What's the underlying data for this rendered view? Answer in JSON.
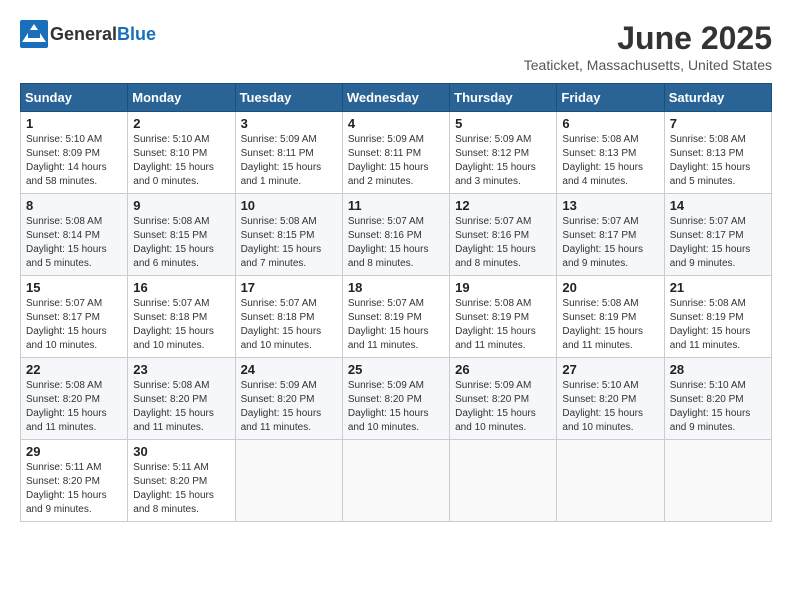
{
  "header": {
    "logo_general": "General",
    "logo_blue": "Blue",
    "month_title": "June 2025",
    "location": "Teaticket, Massachusetts, United States"
  },
  "weekdays": [
    "Sunday",
    "Monday",
    "Tuesday",
    "Wednesday",
    "Thursday",
    "Friday",
    "Saturday"
  ],
  "weeks": [
    [
      {
        "day": "1",
        "info": "Sunrise: 5:10 AM\nSunset: 8:09 PM\nDaylight: 14 hours\nand 58 minutes."
      },
      {
        "day": "2",
        "info": "Sunrise: 5:10 AM\nSunset: 8:10 PM\nDaylight: 15 hours\nand 0 minutes."
      },
      {
        "day": "3",
        "info": "Sunrise: 5:09 AM\nSunset: 8:11 PM\nDaylight: 15 hours\nand 1 minute."
      },
      {
        "day": "4",
        "info": "Sunrise: 5:09 AM\nSunset: 8:11 PM\nDaylight: 15 hours\nand 2 minutes."
      },
      {
        "day": "5",
        "info": "Sunrise: 5:09 AM\nSunset: 8:12 PM\nDaylight: 15 hours\nand 3 minutes."
      },
      {
        "day": "6",
        "info": "Sunrise: 5:08 AM\nSunset: 8:13 PM\nDaylight: 15 hours\nand 4 minutes."
      },
      {
        "day": "7",
        "info": "Sunrise: 5:08 AM\nSunset: 8:13 PM\nDaylight: 15 hours\nand 5 minutes."
      }
    ],
    [
      {
        "day": "8",
        "info": "Sunrise: 5:08 AM\nSunset: 8:14 PM\nDaylight: 15 hours\nand 5 minutes."
      },
      {
        "day": "9",
        "info": "Sunrise: 5:08 AM\nSunset: 8:15 PM\nDaylight: 15 hours\nand 6 minutes."
      },
      {
        "day": "10",
        "info": "Sunrise: 5:08 AM\nSunset: 8:15 PM\nDaylight: 15 hours\nand 7 minutes."
      },
      {
        "day": "11",
        "info": "Sunrise: 5:07 AM\nSunset: 8:16 PM\nDaylight: 15 hours\nand 8 minutes."
      },
      {
        "day": "12",
        "info": "Sunrise: 5:07 AM\nSunset: 8:16 PM\nDaylight: 15 hours\nand 8 minutes."
      },
      {
        "day": "13",
        "info": "Sunrise: 5:07 AM\nSunset: 8:17 PM\nDaylight: 15 hours\nand 9 minutes."
      },
      {
        "day": "14",
        "info": "Sunrise: 5:07 AM\nSunset: 8:17 PM\nDaylight: 15 hours\nand 9 minutes."
      }
    ],
    [
      {
        "day": "15",
        "info": "Sunrise: 5:07 AM\nSunset: 8:17 PM\nDaylight: 15 hours\nand 10 minutes."
      },
      {
        "day": "16",
        "info": "Sunrise: 5:07 AM\nSunset: 8:18 PM\nDaylight: 15 hours\nand 10 minutes."
      },
      {
        "day": "17",
        "info": "Sunrise: 5:07 AM\nSunset: 8:18 PM\nDaylight: 15 hours\nand 10 minutes."
      },
      {
        "day": "18",
        "info": "Sunrise: 5:07 AM\nSunset: 8:19 PM\nDaylight: 15 hours\nand 11 minutes."
      },
      {
        "day": "19",
        "info": "Sunrise: 5:08 AM\nSunset: 8:19 PM\nDaylight: 15 hours\nand 11 minutes."
      },
      {
        "day": "20",
        "info": "Sunrise: 5:08 AM\nSunset: 8:19 PM\nDaylight: 15 hours\nand 11 minutes."
      },
      {
        "day": "21",
        "info": "Sunrise: 5:08 AM\nSunset: 8:19 PM\nDaylight: 15 hours\nand 11 minutes."
      }
    ],
    [
      {
        "day": "22",
        "info": "Sunrise: 5:08 AM\nSunset: 8:20 PM\nDaylight: 15 hours\nand 11 minutes."
      },
      {
        "day": "23",
        "info": "Sunrise: 5:08 AM\nSunset: 8:20 PM\nDaylight: 15 hours\nand 11 minutes."
      },
      {
        "day": "24",
        "info": "Sunrise: 5:09 AM\nSunset: 8:20 PM\nDaylight: 15 hours\nand 11 minutes."
      },
      {
        "day": "25",
        "info": "Sunrise: 5:09 AM\nSunset: 8:20 PM\nDaylight: 15 hours\nand 10 minutes."
      },
      {
        "day": "26",
        "info": "Sunrise: 5:09 AM\nSunset: 8:20 PM\nDaylight: 15 hours\nand 10 minutes."
      },
      {
        "day": "27",
        "info": "Sunrise: 5:10 AM\nSunset: 8:20 PM\nDaylight: 15 hours\nand 10 minutes."
      },
      {
        "day": "28",
        "info": "Sunrise: 5:10 AM\nSunset: 8:20 PM\nDaylight: 15 hours\nand 9 minutes."
      }
    ],
    [
      {
        "day": "29",
        "info": "Sunrise: 5:11 AM\nSunset: 8:20 PM\nDaylight: 15 hours\nand 9 minutes."
      },
      {
        "day": "30",
        "info": "Sunrise: 5:11 AM\nSunset: 8:20 PM\nDaylight: 15 hours\nand 8 minutes."
      },
      null,
      null,
      null,
      null,
      null
    ]
  ]
}
